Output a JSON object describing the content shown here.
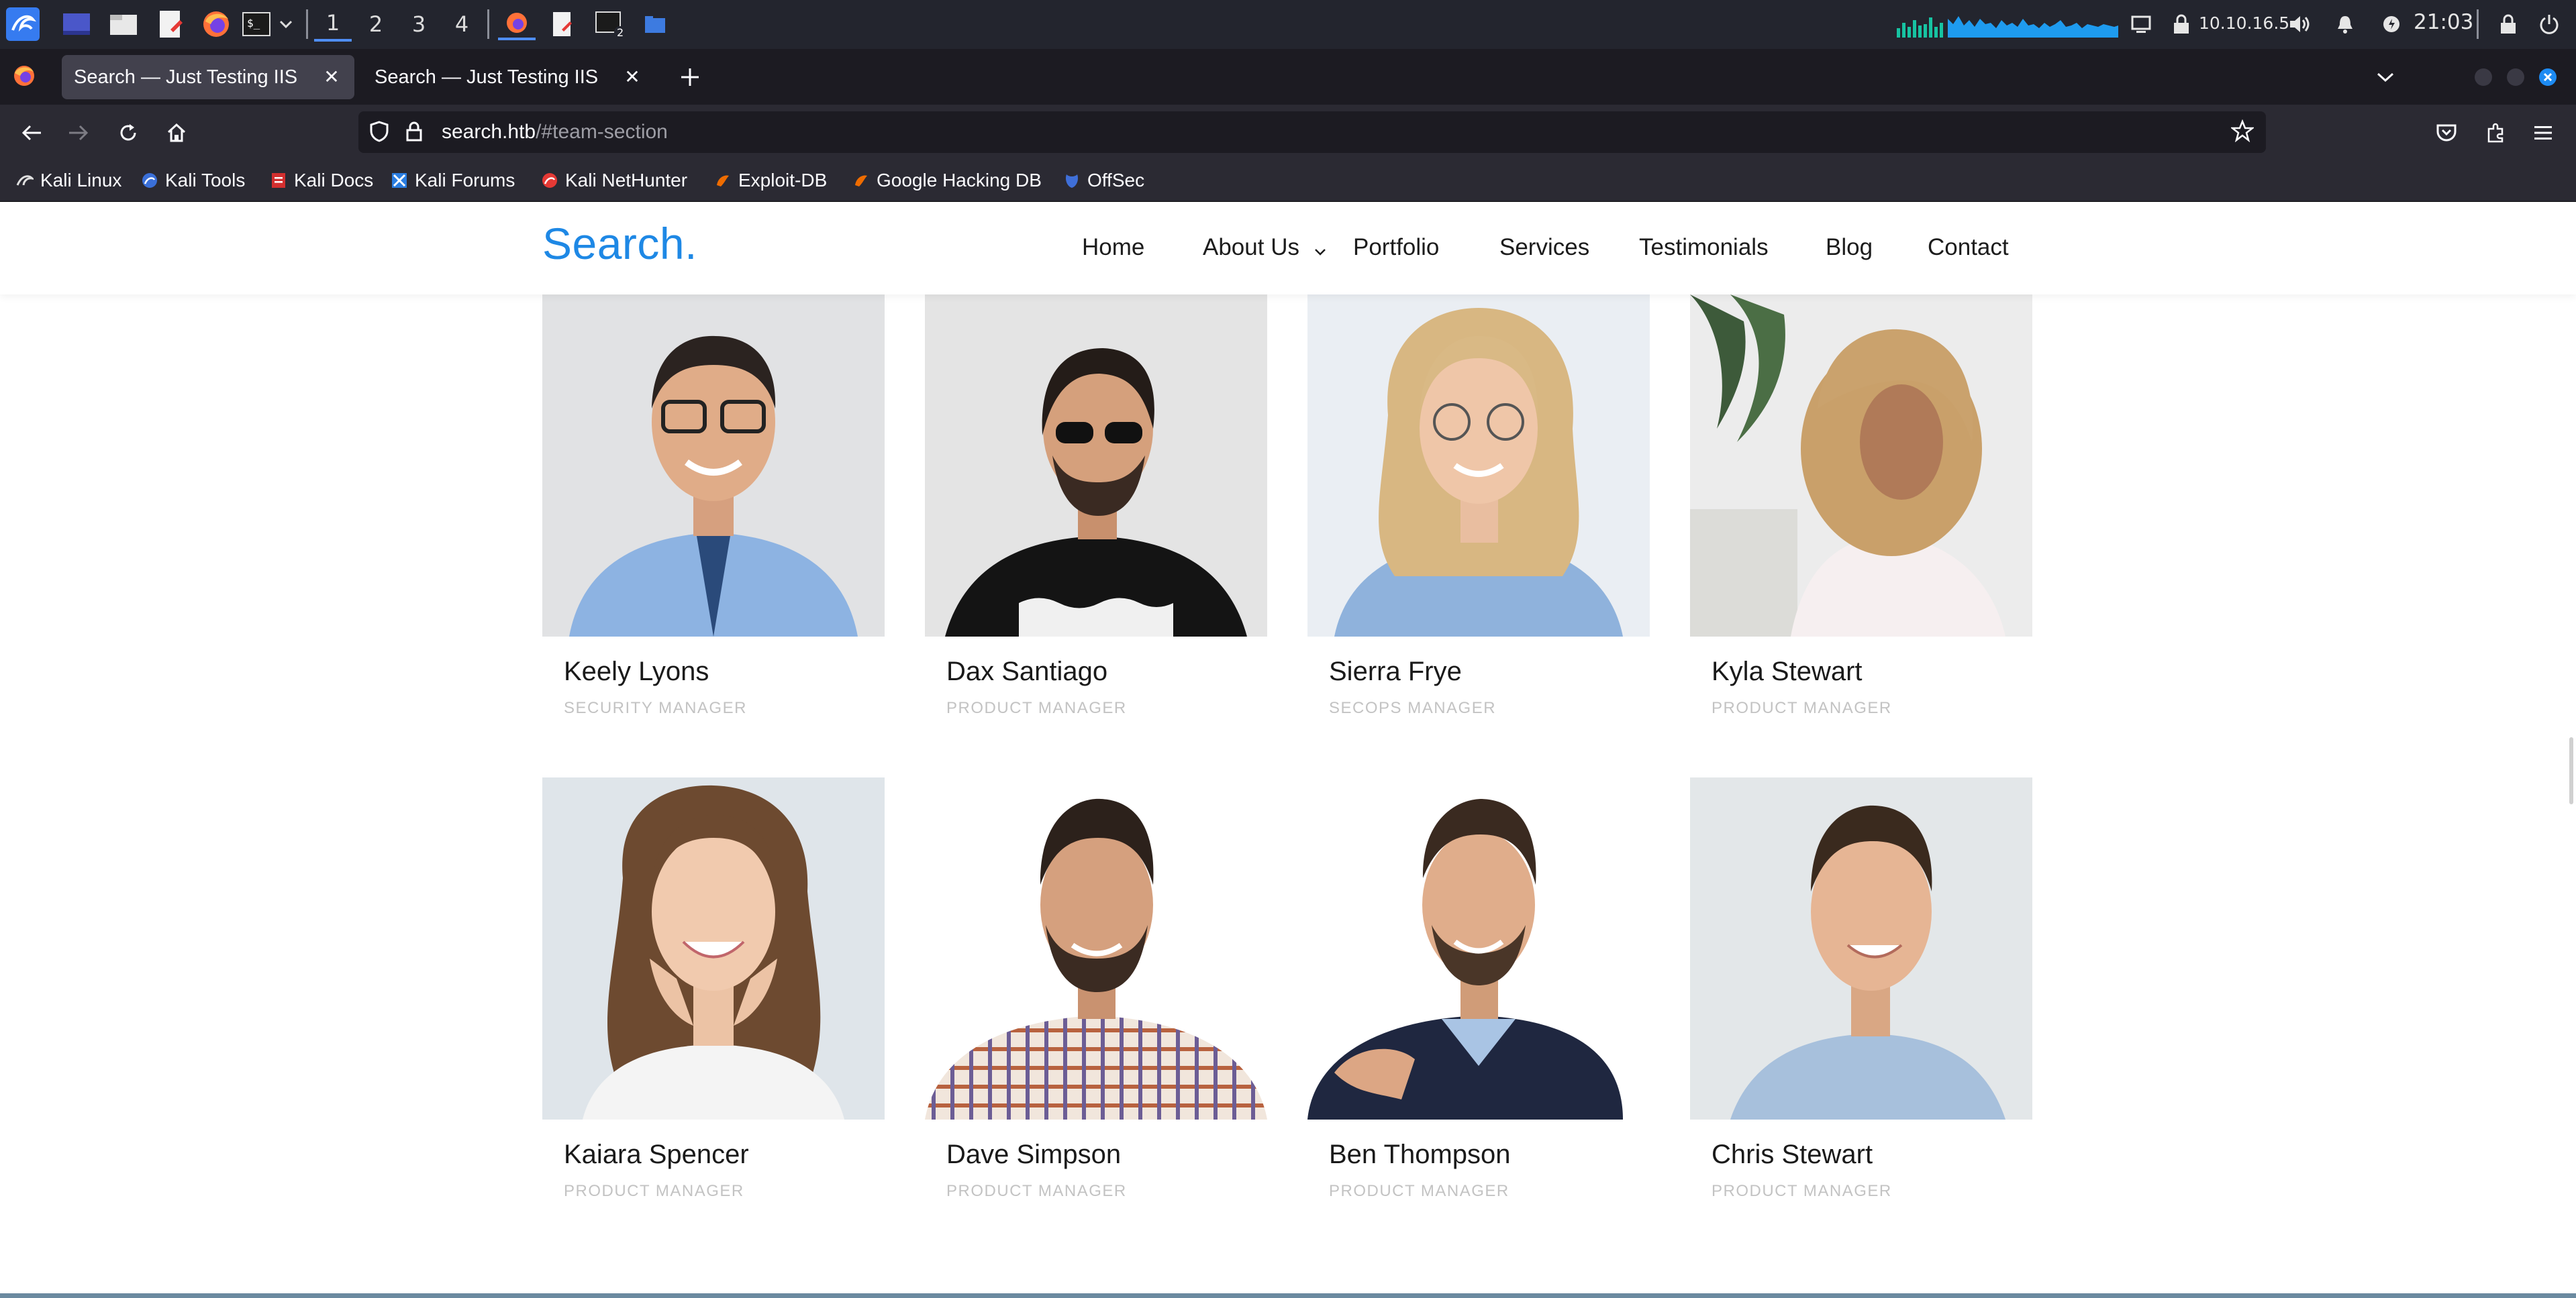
{
  "os_panel": {
    "workspaces": [
      "1",
      "2",
      "3",
      "4"
    ],
    "active_workspace": "1",
    "ip_address": "10.10.16.5",
    "clock": "21:03"
  },
  "browser": {
    "tabs": [
      {
        "title": "Search — Just Testing IIS",
        "active": true
      },
      {
        "title": "Search — Just Testing IIS",
        "active": false
      }
    ],
    "url": {
      "host": "search.htb",
      "path": "/#team-section"
    },
    "bookmarks": [
      "Kali Linux",
      "Kali Tools",
      "Kali Docs",
      "Kali Forums",
      "Kali NetHunter",
      "Exploit-DB",
      "Google Hacking DB",
      "OffSec"
    ]
  },
  "site": {
    "logo": "Search.",
    "menu": [
      "Home",
      "About Us",
      "Portfolio",
      "Services",
      "Testimonials",
      "Blog",
      "Contact"
    ]
  },
  "team": [
    {
      "name": "Keely Lyons",
      "role": "SECURITY MANAGER"
    },
    {
      "name": "Dax Santiago",
      "role": "PRODUCT MANAGER"
    },
    {
      "name": "Sierra Frye",
      "role": "SECOPS MANAGER"
    },
    {
      "name": "Kyla Stewart",
      "role": "PRODUCT MANAGER"
    },
    {
      "name": "Kaiara Spencer",
      "role": "PRODUCT MANAGER"
    },
    {
      "name": "Dave Simpson",
      "role": "PRODUCT MANAGER"
    },
    {
      "name": "Ben Thompson",
      "role": "PRODUCT MANAGER"
    },
    {
      "name": "Chris Stewart",
      "role": "PRODUCT MANAGER"
    }
  ],
  "colors": {
    "brand_blue": "#1e88e5",
    "panel_bg": "#23252e",
    "tab_strip_bg": "#1c1b22",
    "toolbar_bg": "#2b2a33",
    "role_text": "#c3c3c3"
  }
}
